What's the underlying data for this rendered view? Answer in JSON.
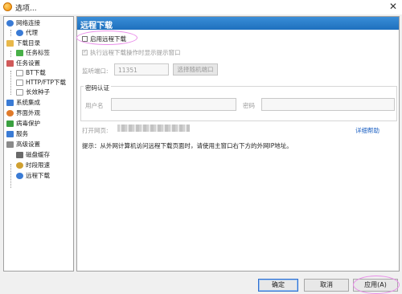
{
  "window": {
    "title": "选项...",
    "close_glyph": "✕"
  },
  "sidebar": {
    "items": [
      {
        "label": "网络连接",
        "icon": "network-icon",
        "color": "#3a7bd5"
      },
      {
        "label": "代理",
        "icon": "proxy-icon",
        "color": "#3a7bd5"
      },
      {
        "label": "下载目录",
        "icon": "folder-icon",
        "color": "#e8b84a"
      },
      {
        "label": "任务标签",
        "icon": "tag-icon",
        "color": "#48b048"
      },
      {
        "label": "任务设置",
        "icon": "task-settings-icon",
        "color": "#d05a5a"
      },
      {
        "label": "BT下载",
        "icon": "bt-doc-icon",
        "color": "#c0c0c0"
      },
      {
        "label": "HTTP/FTP下载",
        "icon": "http-doc-icon",
        "color": "#c0c0c0"
      },
      {
        "label": "长效种子",
        "icon": "seed-doc-icon",
        "color": "#c0c0c0"
      },
      {
        "label": "系统集成",
        "icon": "integration-icon",
        "color": "#3a7bd5"
      },
      {
        "label": "界面外观",
        "icon": "appearance-icon",
        "color": "#e07a2a"
      },
      {
        "label": "病毒保护",
        "icon": "virus-shield-icon",
        "color": "#3aa040"
      },
      {
        "label": "服务",
        "icon": "service-icon",
        "color": "#3a7bd5"
      },
      {
        "label": "高级设置",
        "icon": "advanced-icon",
        "color": "#8a8a8a"
      },
      {
        "label": "磁盘缓存",
        "icon": "disk-cache-icon",
        "color": "#6a6a6a"
      },
      {
        "label": "时段限速",
        "icon": "speed-limit-icon",
        "color": "#d0a030"
      },
      {
        "label": "远程下载",
        "icon": "remote-download-icon",
        "color": "#3a7bd5"
      }
    ]
  },
  "content": {
    "section_title": "远程下载",
    "enable_remote": {
      "label": "启用远程下载",
      "checked": false
    },
    "prompt_window": {
      "label": "执行远程下载操作时显示提示窗口",
      "checked": true,
      "disabled": true
    },
    "port": {
      "label": "监听端口:",
      "value": "11351",
      "random_button": "选择随机端口"
    },
    "auth": {
      "title": "密码认证",
      "username_label": "用户名",
      "password_label": "密码"
    },
    "webpage": {
      "label": "打开网页:",
      "help_link": "详细帮助"
    },
    "hint": "提示：从外网计算机访问远程下载页面时，请使用主窗口右下方的外网IP地址。"
  },
  "buttons": {
    "ok": "确定",
    "cancel": "取消",
    "apply": "应用(A)"
  },
  "colors": {
    "header_blue": "#2a7fd0",
    "highlight_pink": "#e98ee9",
    "link_blue": "#1a5fc2"
  }
}
